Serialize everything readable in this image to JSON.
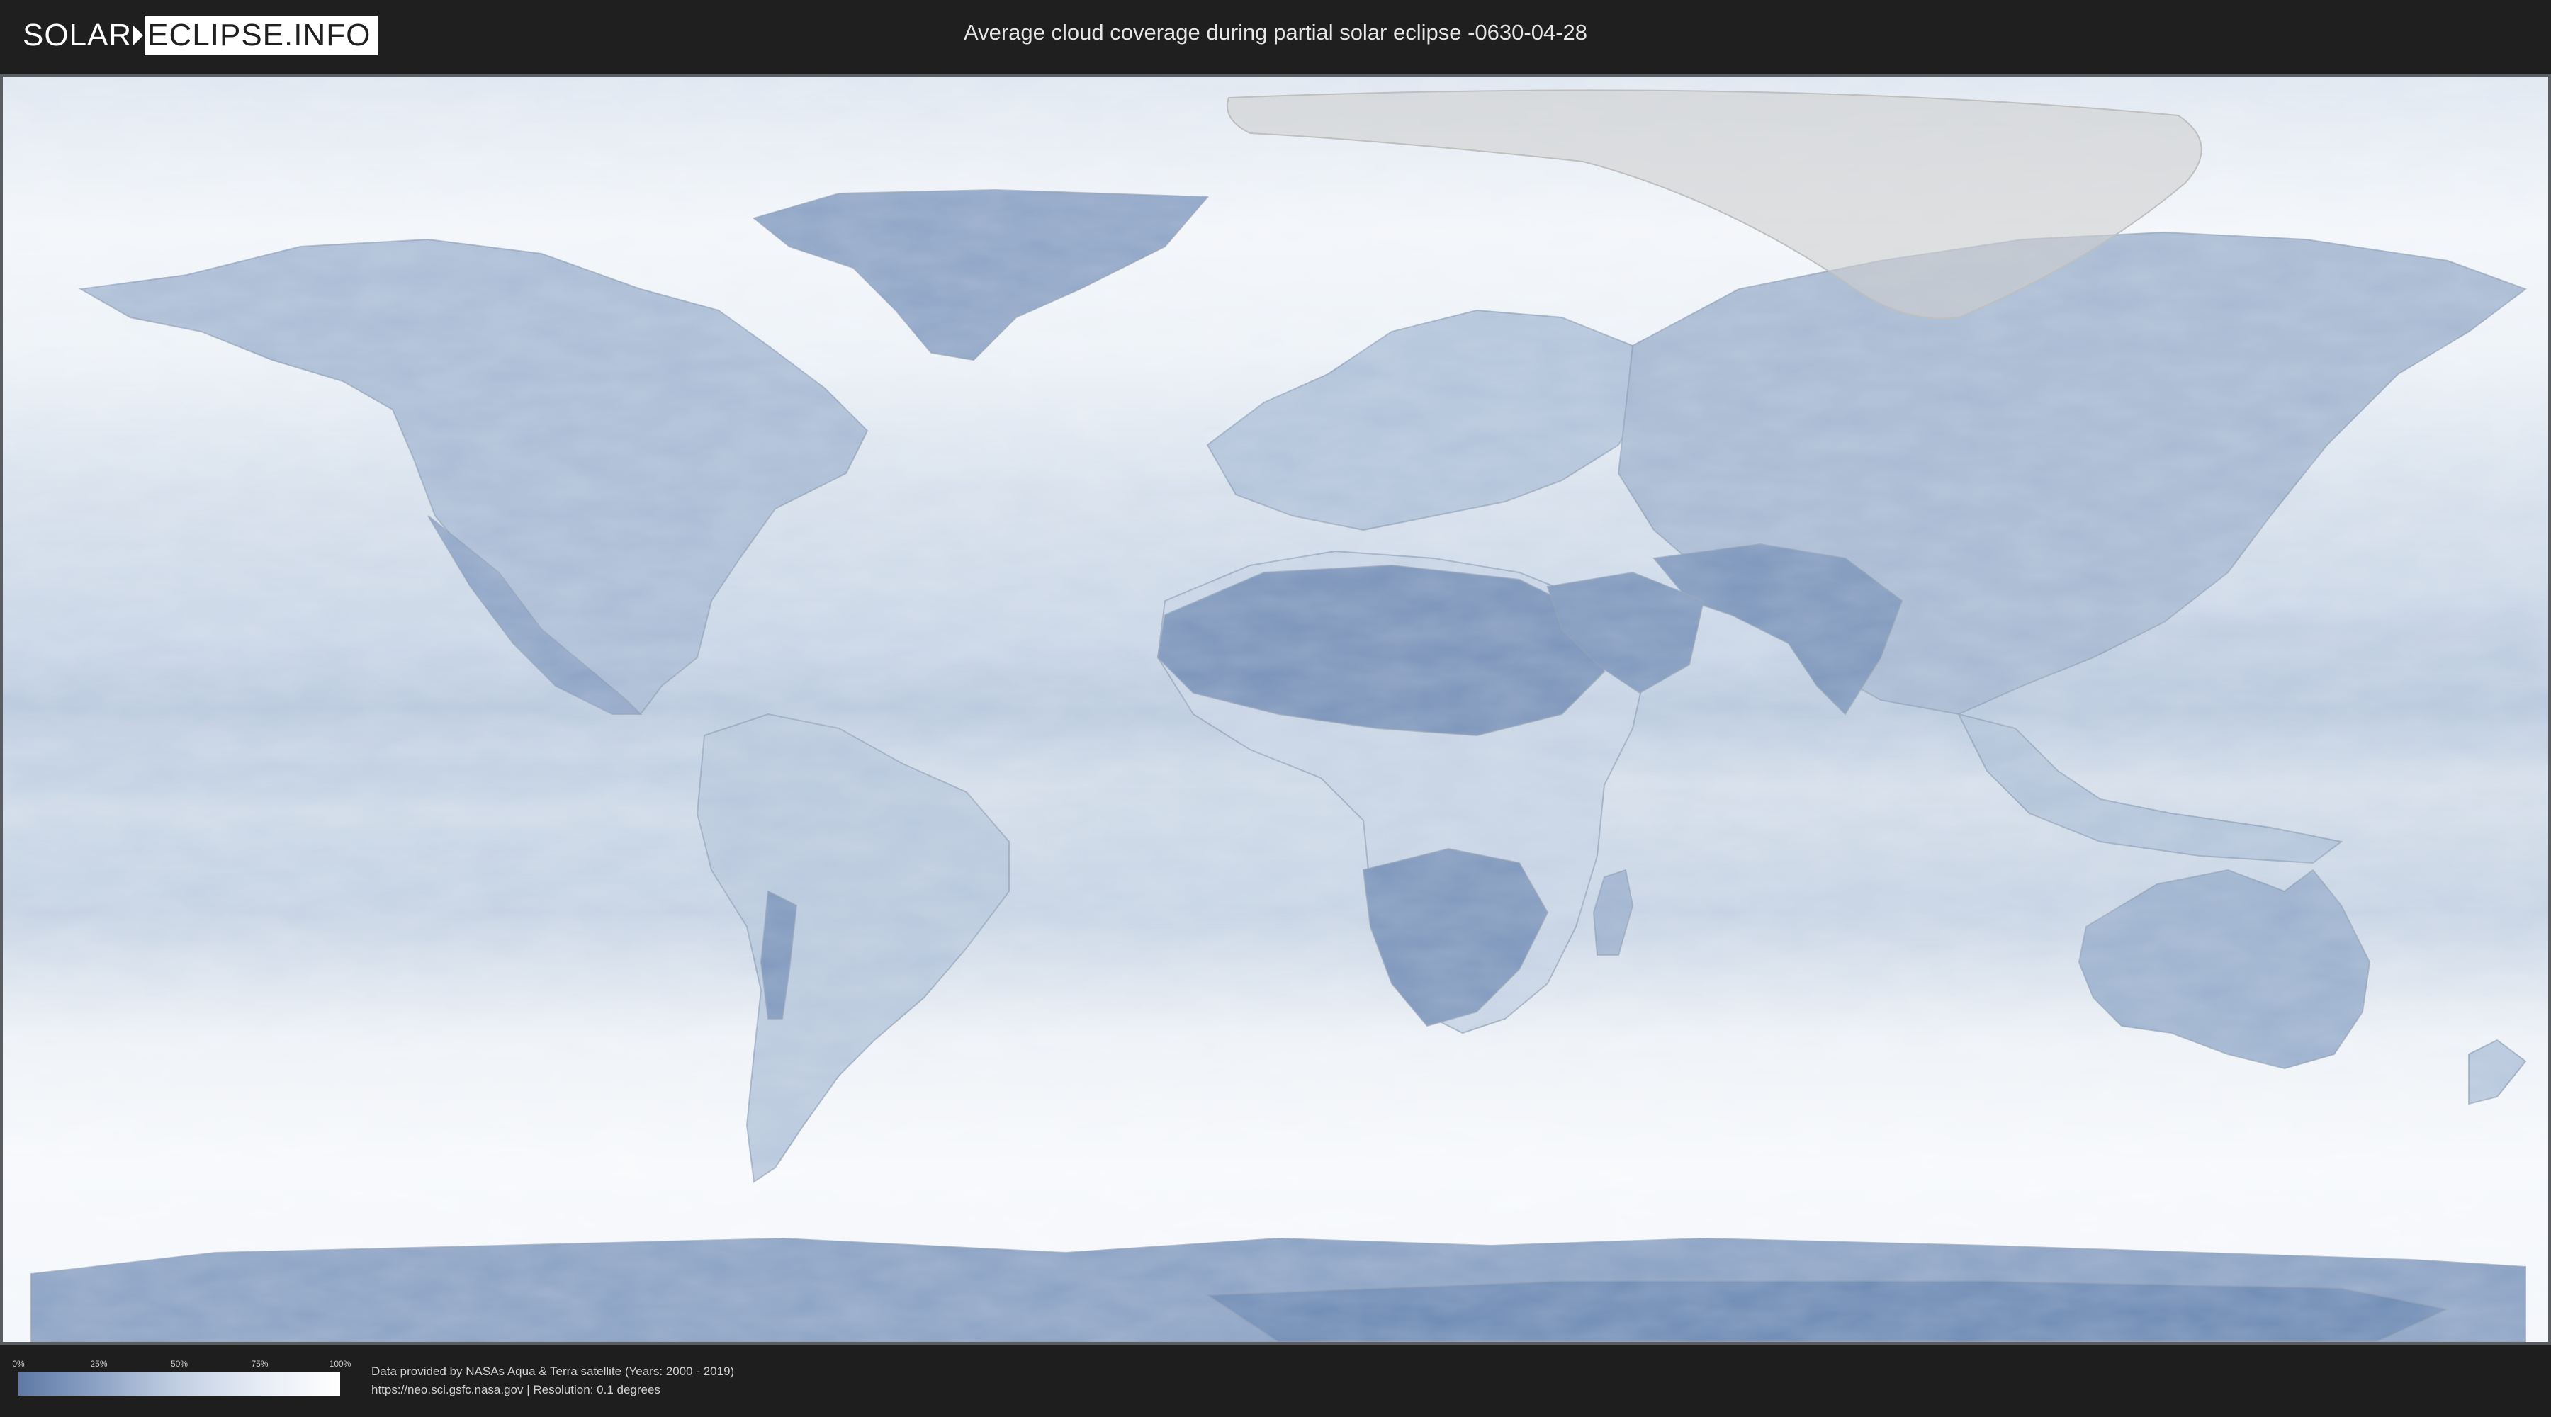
{
  "header": {
    "logo_left": "SOLAR",
    "logo_right": "ECLIPSE.INFO",
    "title": "Average cloud coverage during partial solar eclipse -0630-04-28"
  },
  "colors": {
    "background": "#1f1f1f",
    "clear_sky": "#5e79a6",
    "cloud_full": "#ffffff",
    "eclipse_zone": "#cfcfcf"
  },
  "legend": {
    "ticks": [
      "0%",
      "25%",
      "50%",
      "75%",
      "100%"
    ]
  },
  "footer": {
    "credit_line1": "Data provided by NASAs Aqua & Terra satellite (Years: 2000 - 2019)",
    "credit_line2": "https://neo.sci.gsfc.nasa.gov | Resolution: 0.1 degrees"
  }
}
